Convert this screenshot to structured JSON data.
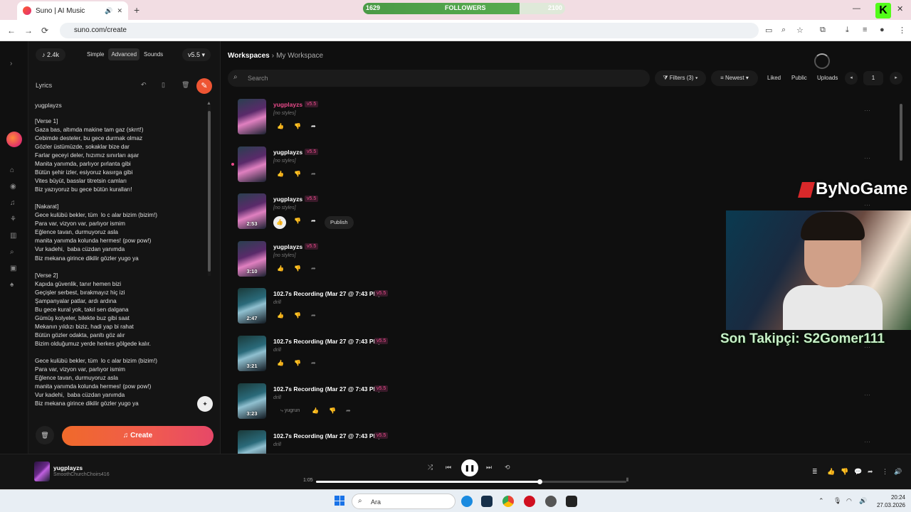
{
  "browser": {
    "tab_title": "Suno | AI Music",
    "url": "suno.com/create",
    "new_tab": "+",
    "back": "←",
    "forward": "→",
    "reload": "⟳"
  },
  "followers": {
    "current": "1629",
    "label": "FOLLOWERS",
    "goal": "2100",
    "progress_fraction": 0.776
  },
  "sidebar": {
    "credits": "2.4k",
    "modes": [
      "Simple",
      "Advanced",
      "Sounds"
    ],
    "active_mode": "Advanced",
    "version": "v5.5",
    "lyrics_label": "Lyrics",
    "song_title": "yugplayzs",
    "lyrics": "[Verse 1]\nGaza bas, altımda makine tam gaz (skrrt!)\nCebimde desteler, bu gece durmak olmaz\nGözler üstümüzde, sokaklar bize dar\nFarlar geceyi deler, hızımız sınırları aşar\nManita yanımda, parlıyor pırlanta gibi\nBütün şehir izler, esiyoruz kasırga gibi\nVites büyüt, basslar titretsin camları\nBiz yazıyoruz bu gece bütün kuralları!\n\n[Nakarat]\nGece kulübü bekler, tüm  lo c alar bizim (bizim!)\nPara var, vizyon var, parlıyor ismim\nEğlence tavan, durmuyoruz asla\nmanita yanımda kolunda hermes! (pow pow!)\nVur kadehi,  baba cüzdan yanımda\nBiz mekana girince dikilir gözler yugo ya\n\n[Verse 2]\nKapıda güvenlik, tanır hemen bizi\nGeçişler serbest, bırakmayız hiç izi\nŞampanyalar patlar, ardı ardına\nBu gece kural yok, takıl sen dalgana\nGümüş kolyeler, bilekte buz gibi saat\nMekanın yıldızı biziz, hadi yap bi rahat\nBütün gözler odakta, panltı göz alır\nBizim olduğumuz yerde herkes gölgede kalır.\n\nGece kulübü bekler, tüm  lo c alar bizim (bizim!)\nPara var, vizyon var, parlıyor ismim\nEğlence tavan, durmuyoruz asla\nmanita yanımda kolunda hermes! (pow pow!)\nVur kadehi,  baba cüzdan yanımda\nBiz mekana girince dikilir gözler yugo ya",
    "create_label": "Create"
  },
  "workspace": {
    "crumb_root": "Workspaces",
    "crumb_current": "My Workspace",
    "search_placeholder": "Search",
    "filters": "Filters (3)",
    "sort": "Newest",
    "liked": "Liked",
    "public": "Public",
    "uploads": "Uploads",
    "page": "1"
  },
  "songs": [
    {
      "title": "yugplayzs",
      "version": "v5.5",
      "style": "[no styles]",
      "duration": "",
      "playing": true,
      "thumb": "car"
    },
    {
      "title": "yugplayzs",
      "version": "v5.5",
      "style": "[no styles]",
      "duration": "",
      "playing": false,
      "thumb": "car"
    },
    {
      "title": "yugplayzs",
      "version": "v5.5",
      "style": "[no styles]",
      "duration": "2:53",
      "playing": false,
      "thumb": "car",
      "publish": "Publish",
      "liked": true
    },
    {
      "title": "yugplayzs",
      "version": "v5.5",
      "style": "[no styles]",
      "duration": "3:10",
      "playing": false,
      "thumb": "car"
    },
    {
      "title": "102.7s Recording (Mar 27 @ 7:43 PM)",
      "version": "v5.5",
      "style": "drill",
      "duration": "2:47",
      "playing": false,
      "thumb": "city"
    },
    {
      "title": "102.7s Recording (Mar 27 @ 7:43 PM)",
      "version": "v5.5",
      "style": "drill",
      "duration": "3:21",
      "playing": false,
      "thumb": "city"
    },
    {
      "title": "102.7s Recording (Mar 27 @ 7:43 PM)",
      "version": "v5.5",
      "style": "drill",
      "duration": "3:23",
      "playing": false,
      "thumb": "city",
      "remix": "yugrun"
    },
    {
      "title": "102.7s Recording (Mar 27 @ 7:43 PM)",
      "version": "v5.5",
      "style": "drill",
      "duration": "",
      "playing": false,
      "thumb": "city"
    }
  ],
  "overlay": {
    "logo": "ByNoGame",
    "last_follower": "Son Takipçi: S2Gomer111"
  },
  "player": {
    "title": "yugplayzs",
    "artist": "SmoothChurchChoirs416",
    "elapsed": "1:05",
    "progress_fraction": 0.72
  },
  "taskbar": {
    "search_label": "Ara",
    "time": "20:24",
    "date": "27.03.2026"
  }
}
